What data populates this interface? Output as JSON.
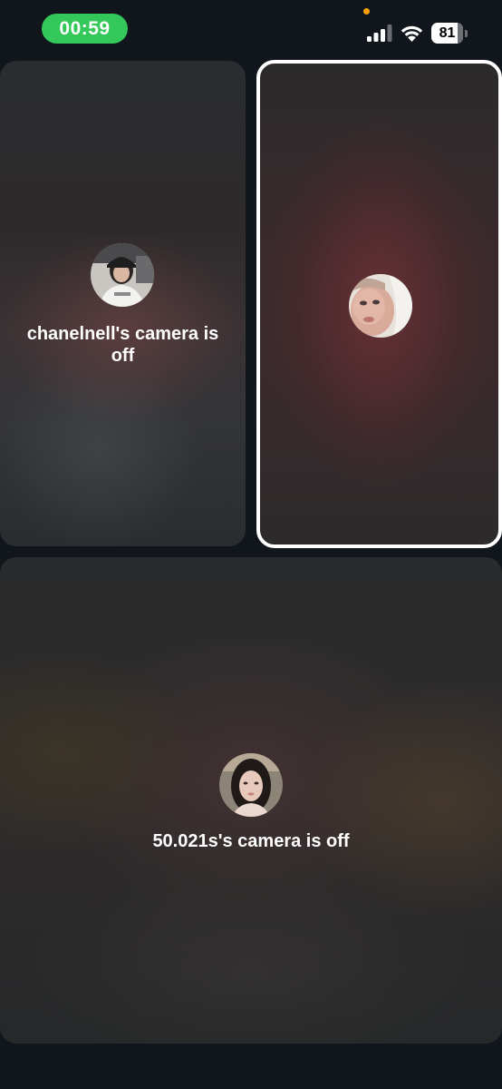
{
  "status_bar": {
    "call_timer": "00:59",
    "battery_level": "81",
    "icons": [
      "orange-dot-indicator",
      "signal-icon",
      "wifi-icon",
      "battery-icon"
    ],
    "colors": {
      "call_timer_bg": "#34c759",
      "indicator": "#ff9f0a"
    }
  },
  "participants": [
    {
      "camera_off_text": "chanelnell's camera is off",
      "avatar": "avatar-photo",
      "active_speaker": false
    },
    {
      "camera_off_text": "",
      "avatar": "avatar-photo",
      "active_speaker": true
    },
    {
      "camera_off_text": "50.021s's camera is off",
      "avatar": "avatar-photo",
      "active_speaker": false
    }
  ],
  "colors": {
    "background": "#10161b",
    "active_border": "#ffffff"
  }
}
